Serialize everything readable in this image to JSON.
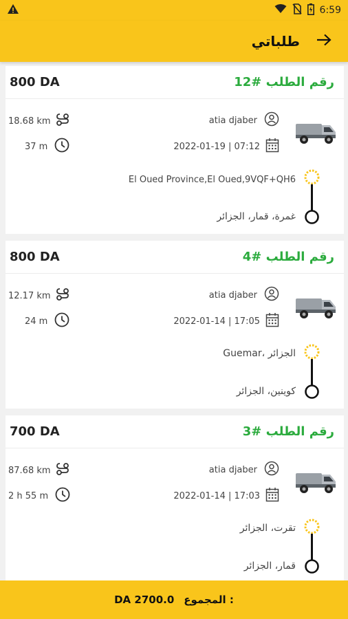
{
  "status": {
    "time": "6:59"
  },
  "app_bar": {
    "title": "طلباتي"
  },
  "orders": [
    {
      "order_label": "رقم الطلب #12",
      "price": "800 DA",
      "driver": "atia djaber",
      "datetime": "2022-01-19 | 07:12",
      "distance": "18.68 km",
      "duration": "37 m",
      "from": "El Oued Province,El Oued,9VQF+QH6",
      "to": "غمرة، قمار، الجزائر"
    },
    {
      "order_label": "رقم الطلب #4",
      "price": "800 DA",
      "driver": "atia djaber",
      "datetime": "2022-01-14 | 17:05",
      "distance": "12.17 km",
      "duration": "24 m",
      "from": "Guemar، الجزائر",
      "to": "كوينين، الجزائر"
    },
    {
      "order_label": "رقم الطلب #3",
      "price": "700 DA",
      "driver": "atia djaber",
      "datetime": "2022-01-14 | 17:03",
      "distance": "87.68 km",
      "duration": "2 h 55 m",
      "from": "تقرت، الجزائر",
      "to": "قمار، الجزائر"
    }
  ],
  "footer": {
    "total_label": "المجموع :",
    "total_value": "DA 2700.0"
  },
  "icons": {
    "warning": "warning-icon",
    "wifi": "wifi-icon",
    "no-sim": "no-sim-icon",
    "battery": "battery-icon",
    "back": "arrow-right-icon",
    "route": "route-icon",
    "clock": "clock-icon",
    "user": "user-icon",
    "calendar": "calendar-icon",
    "truck": "truck-icon",
    "start": "origin-marker-icon",
    "end": "destination-marker-icon"
  },
  "colors": {
    "brand": "#f9c51b",
    "order_green": "#2bab3d"
  }
}
